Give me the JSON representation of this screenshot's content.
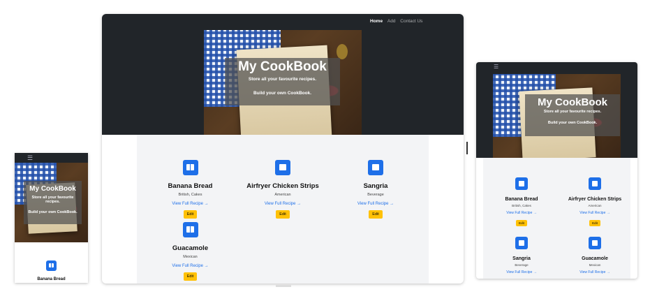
{
  "site": {
    "title": "My CookBook",
    "tagline1": "Store all your favourite recipes.",
    "tagline2": "Build your own CookBook."
  },
  "nav": {
    "home": "Home",
    "add": "Add",
    "contact": "Contact Us",
    "menu_icon": "hamburger-icon"
  },
  "recipes": [
    {
      "title": "Banana Bread",
      "tags": "British, Cakes",
      "link": "View Full Recipe →",
      "edit": "Edit"
    },
    {
      "title": "Airfryer Chicken Strips",
      "tags": "American",
      "link": "View Full Recipe →",
      "edit": "Edit"
    },
    {
      "title": "Sangria",
      "tags": "Beverage",
      "link": "View Full Recipe →",
      "edit": "Edit"
    },
    {
      "title": "Guacamole",
      "tags": "Mexican",
      "link": "View Full Recipe →",
      "edit": "Edit"
    }
  ],
  "icons": {
    "recipe": "book-icon"
  },
  "colors": {
    "navbar": "#212529",
    "accent": "#1e6fe8",
    "edit": "#ffc107"
  }
}
